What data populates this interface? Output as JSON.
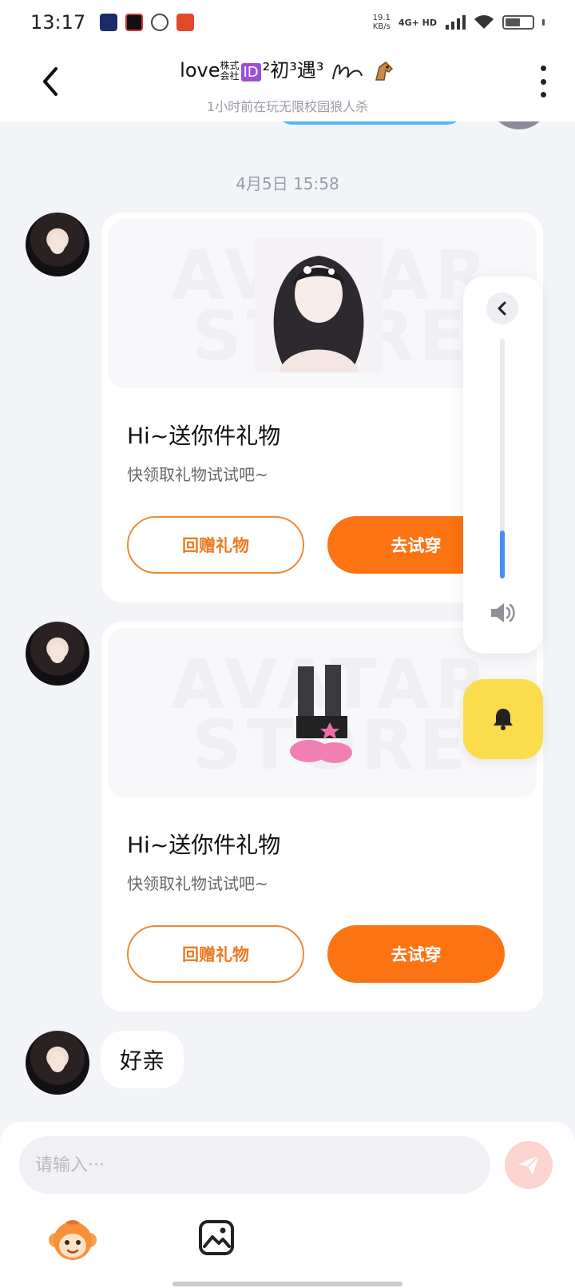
{
  "status_bar": {
    "time": "13:17",
    "net_speed_value": "19.1",
    "net_speed_unit": "KB/s",
    "network_type": "4G+ HD"
  },
  "header": {
    "title_prefix": "love",
    "title_small_top": "株式",
    "title_small_bottom": "会社",
    "title_id_badge": "ID",
    "title_suffix": "²初³遇³",
    "subtitle": "1小时前在玩无限校园狼人杀"
  },
  "chat": {
    "timestamp": "4月5日 15:58",
    "messages": [
      {
        "type": "gift",
        "watermark_line1": "AVATAR",
        "watermark_line2": "STORE",
        "title": "Hi~送你件礼物",
        "description": "快领取礼物试试吧~",
        "return_gift_label": "回赠礼物",
        "try_on_label": "去试穿"
      },
      {
        "type": "gift",
        "watermark_line1": "AVATAR",
        "watermark_line2": "STORE",
        "title": "Hi~送你件礼物",
        "description": "快领取礼物试试吧~",
        "return_gift_label": "回赠礼物",
        "try_on_label": "去试穿"
      },
      {
        "type": "text",
        "text": "好亲"
      }
    ]
  },
  "volume_panel": {
    "level": 0.2
  },
  "input": {
    "placeholder": "请输入···"
  },
  "colors": {
    "accent_orange": "#fb7312",
    "outline_orange": "#ee8a36",
    "volume_blue": "#4a8df6",
    "bell_yellow": "#fbdc4c",
    "send_disabled": "#fdd4d0"
  },
  "icons": {
    "back": "chevron-left-icon",
    "more": "more-vertical-icon",
    "collapse": "chevron-left-icon",
    "speaker": "speaker-icon",
    "bell": "bell-icon",
    "send": "paper-plane-icon",
    "mascot": "monkey-mascot-icon",
    "image": "image-icon"
  }
}
